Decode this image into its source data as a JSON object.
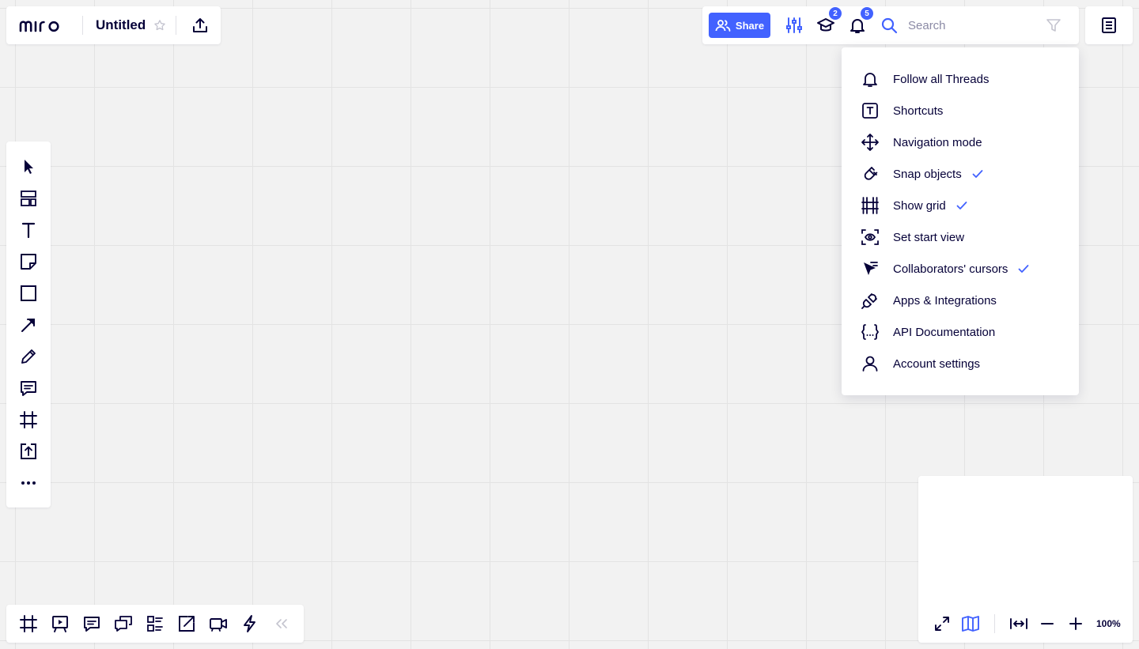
{
  "board": {
    "title": "Untitled"
  },
  "top_toolbar": {
    "share_label": "Share",
    "education_badge": "2",
    "notifications_badge": "5",
    "search_placeholder": "Search"
  },
  "menu": {
    "items": [
      {
        "label": "Follow all Threads",
        "icon": "bell-icon",
        "checked": false
      },
      {
        "label": "Shortcuts",
        "icon": "keyboard-t-icon",
        "checked": false
      },
      {
        "label": "Navigation mode",
        "icon": "move-arrows-icon",
        "checked": false
      },
      {
        "label": "Snap objects",
        "icon": "magnet-icon",
        "checked": true
      },
      {
        "label": "Show grid",
        "icon": "grid-icon",
        "checked": true
      },
      {
        "label": "Set start view",
        "icon": "eye-frame-icon",
        "checked": false
      },
      {
        "label": "Collaborators' cursors",
        "icon": "cursor-icon",
        "checked": true
      },
      {
        "label": "Apps & Integrations",
        "icon": "plug-icon",
        "checked": false
      },
      {
        "label": "API Documentation",
        "icon": "braces-icon",
        "checked": false
      },
      {
        "label": "Account settings",
        "icon": "user-icon",
        "checked": false
      }
    ]
  },
  "zoom": {
    "level": "100%"
  },
  "colors": {
    "accent": "#4262ff",
    "text": "#050038",
    "canvas": "#f2f2f2"
  }
}
